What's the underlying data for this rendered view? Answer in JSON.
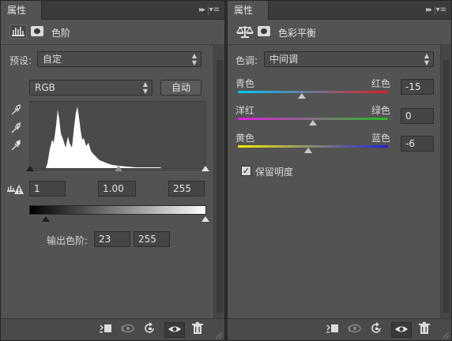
{
  "left_panel": {
    "tab_label": "属性",
    "collapse_glyph": "▸▸",
    "menu_glyph": "▾≡",
    "adjustment_title": "色阶",
    "preset": {
      "label": "预设:",
      "value": "自定"
    },
    "channel": {
      "value": "RGB"
    },
    "auto_button": "自动",
    "input_levels": {
      "black": "1",
      "gamma": "1.00",
      "white": "255"
    },
    "output_levels": {
      "label": "输出色阶:",
      "black": "23",
      "white": "255"
    },
    "icons": [
      "levels-icon",
      "mask-icon",
      "eyedropper-black-icon",
      "eyedropper-gray-icon",
      "eyedropper-white-icon",
      "clipping-warning-icon"
    ],
    "footer_icons": [
      "clip-to-layer-icon",
      "view-previous-icon",
      "reset-icon",
      "visibility-icon",
      "delete-icon"
    ]
  },
  "right_panel": {
    "tab_label": "属性",
    "collapse_glyph": "▸▸",
    "menu_glyph": "▾≡",
    "adjustment_title": "色彩平衡",
    "tone": {
      "label": "色调:",
      "value": "中间调"
    },
    "sliders": [
      {
        "left": "青色",
        "right": "红色",
        "value": "-15",
        "level": -15,
        "track_from": "#00c8ff",
        "track_to": "#e02020"
      },
      {
        "left": "洋红",
        "right": "绿色",
        "value": "0",
        "level": 0,
        "track_from": "#e020e0",
        "track_to": "#20c020"
      },
      {
        "left": "黄色",
        "right": "蓝色",
        "value": "-6",
        "level": -6,
        "track_from": "#f0f000",
        "track_to": "#2020e0"
      }
    ],
    "preserve_luminosity": {
      "label": "保留明度",
      "checked": true
    },
    "icons": [
      "color-balance-icon",
      "mask-icon"
    ],
    "footer_icons": [
      "clip-to-layer-icon",
      "view-previous-icon",
      "reset-icon",
      "visibility-icon",
      "delete-icon"
    ]
  },
  "colors": {
    "panel_bg": "#535353",
    "tab_bar": "#3b3b3b",
    "field_bg": "#454545",
    "histogram_bg": "#4a4a4a"
  }
}
